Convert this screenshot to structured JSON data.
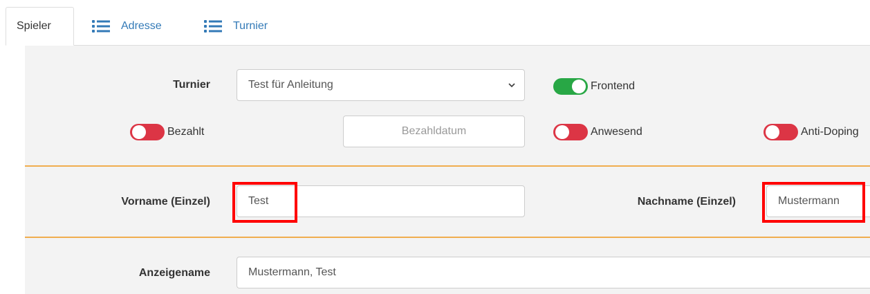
{
  "tabs": [
    {
      "label": "Spieler",
      "icon": "",
      "active": true
    },
    {
      "label": "Adresse",
      "icon": "list-icon",
      "active": false
    },
    {
      "label": "Turnier",
      "icon": "list-icon",
      "active": false
    }
  ],
  "colors": {
    "accent_link": "#337ab7",
    "toggle_on": "#28a745",
    "toggle_off": "#dc3545",
    "divider": "#f0ad4e",
    "highlight": "#ff0000",
    "panel_bg": "#f3f3f3"
  },
  "form": {
    "turnier": {
      "label": "Turnier",
      "value": "Test für Anleitung"
    },
    "frontend": {
      "label": "Frontend",
      "on": true
    },
    "bezahlt": {
      "label": "Bezahlt",
      "on": false
    },
    "bezahldatum": {
      "placeholder": "Bezahldatum",
      "value": ""
    },
    "anwesend": {
      "label": "Anwesend",
      "on": false
    },
    "antidoping": {
      "label": "Anti-Doping",
      "on": false
    },
    "vorname": {
      "label": "Vorname (Einzel)",
      "value": "Test"
    },
    "nachname": {
      "label": "Nachname (Einzel)",
      "value": "Mustermann"
    },
    "anzeigename": {
      "label": "Anzeigename",
      "value": "Mustermann, Test"
    }
  }
}
